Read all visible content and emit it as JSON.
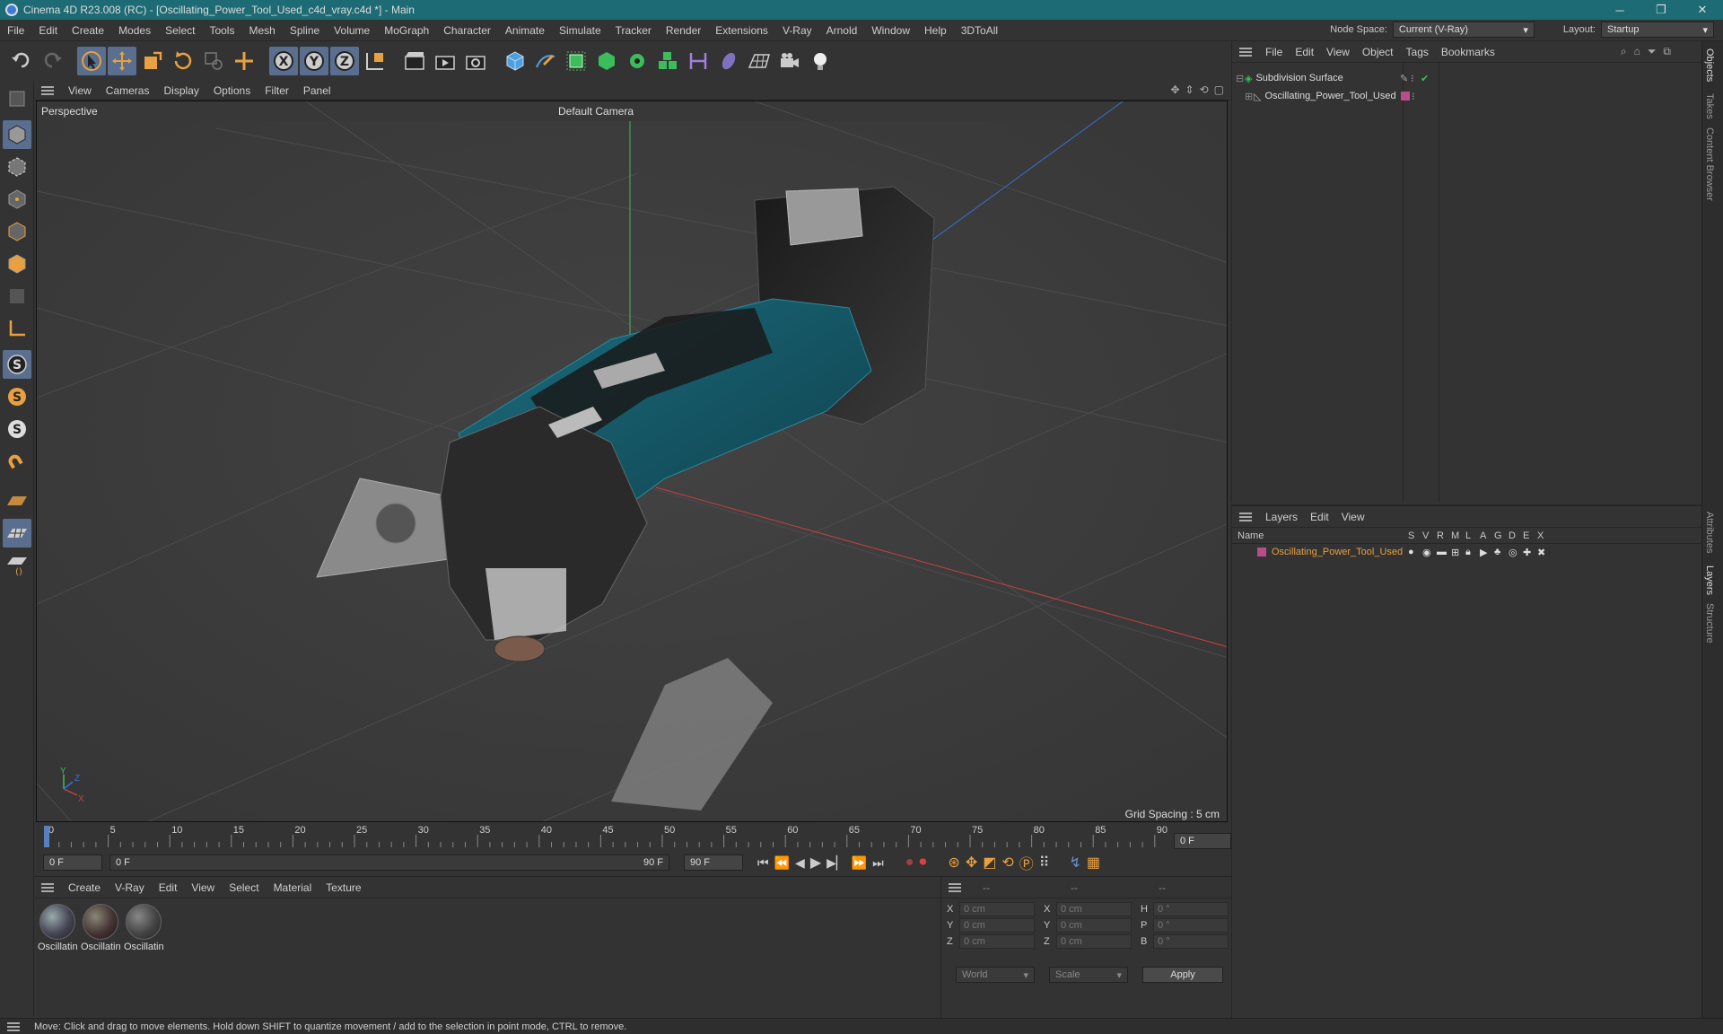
{
  "window": {
    "title": "Cinema 4D R23.008 (RC) - [Oscillating_Power_Tool_Used_c4d_vray.c4d *] - Main"
  },
  "menubar": {
    "items": [
      "File",
      "Edit",
      "Create",
      "Modes",
      "Select",
      "Tools",
      "Mesh",
      "Spline",
      "Volume",
      "MoGraph",
      "Character",
      "Animate",
      "Simulate",
      "Tracker",
      "Render",
      "Extensions",
      "V-Ray",
      "Arnold",
      "Window",
      "Help",
      "3DToAll"
    ],
    "node_space_label": "Node Space:",
    "node_space_value": "Current (V-Ray)",
    "layout_label": "Layout:",
    "layout_value": "Startup"
  },
  "viewport": {
    "menu": [
      "View",
      "Cameras",
      "Display",
      "Options",
      "Filter",
      "Panel"
    ],
    "view_name": "Perspective",
    "camera": "Default Camera",
    "grid_spacing": "Grid Spacing : 5 cm",
    "axis_labels": {
      "y": "Y",
      "z": "Z",
      "x": "X"
    }
  },
  "timeline": {
    "ticks": [
      "0",
      "5",
      "10",
      "15",
      "20",
      "25",
      "30",
      "35",
      "40",
      "45",
      "50",
      "55",
      "60",
      "65",
      "70",
      "75",
      "80",
      "85",
      "90"
    ],
    "current_frame_right": "0 F",
    "start_field": "0 F",
    "range_start": "0 F",
    "range_end": "90 F",
    "end_field": "90 F"
  },
  "materials": {
    "menu": [
      "Create",
      "V-Ray",
      "Edit",
      "View",
      "Select",
      "Material",
      "Texture"
    ],
    "items": [
      "Oscillatin",
      "Oscillatin",
      "Oscillatin"
    ]
  },
  "coords": {
    "headers": [
      "--",
      "--",
      "--"
    ],
    "rows": [
      {
        "a": "X",
        "av": "0 cm",
        "b": "X",
        "bv": "0 cm",
        "c": "H",
        "cv": "0 °"
      },
      {
        "a": "Y",
        "av": "0 cm",
        "b": "Y",
        "bv": "0 cm",
        "c": "P",
        "cv": "0 °"
      },
      {
        "a": "Z",
        "av": "0 cm",
        "b": "Z",
        "bv": "0 cm",
        "c": "B",
        "cv": "0 °"
      }
    ],
    "world": "World",
    "scale": "Scale",
    "apply": "Apply"
  },
  "objects": {
    "menu": [
      "File",
      "Edit",
      "View",
      "Object",
      "Tags",
      "Bookmarks"
    ],
    "items": [
      {
        "name": "Subdivision Surface"
      },
      {
        "name": "Oscillating_Power_Tool_Used"
      }
    ]
  },
  "layers": {
    "menu": [
      "Layers",
      "Edit",
      "View"
    ],
    "name_header": "Name",
    "col_headers": [
      "S",
      "V",
      "R",
      "M",
      "L",
      "A",
      "G",
      "D",
      "E",
      "X"
    ],
    "items": [
      {
        "name": "Oscillating_Power_Tool_Used",
        "color": "#b84d8c"
      }
    ]
  },
  "sidetabs": [
    "Objects",
    "Takes",
    "Content Browser",
    "Attributes",
    "Layers",
    "Structure"
  ],
  "status": {
    "text": "Move: Click and drag to move elements. Hold down SHIFT to quantize movement / add to the selection in point mode, CTRL to remove."
  },
  "colors": {
    "accent_blue": "#5a6f8f",
    "layer_orange": "#e8a040",
    "title_teal": "#1f6f7a"
  }
}
